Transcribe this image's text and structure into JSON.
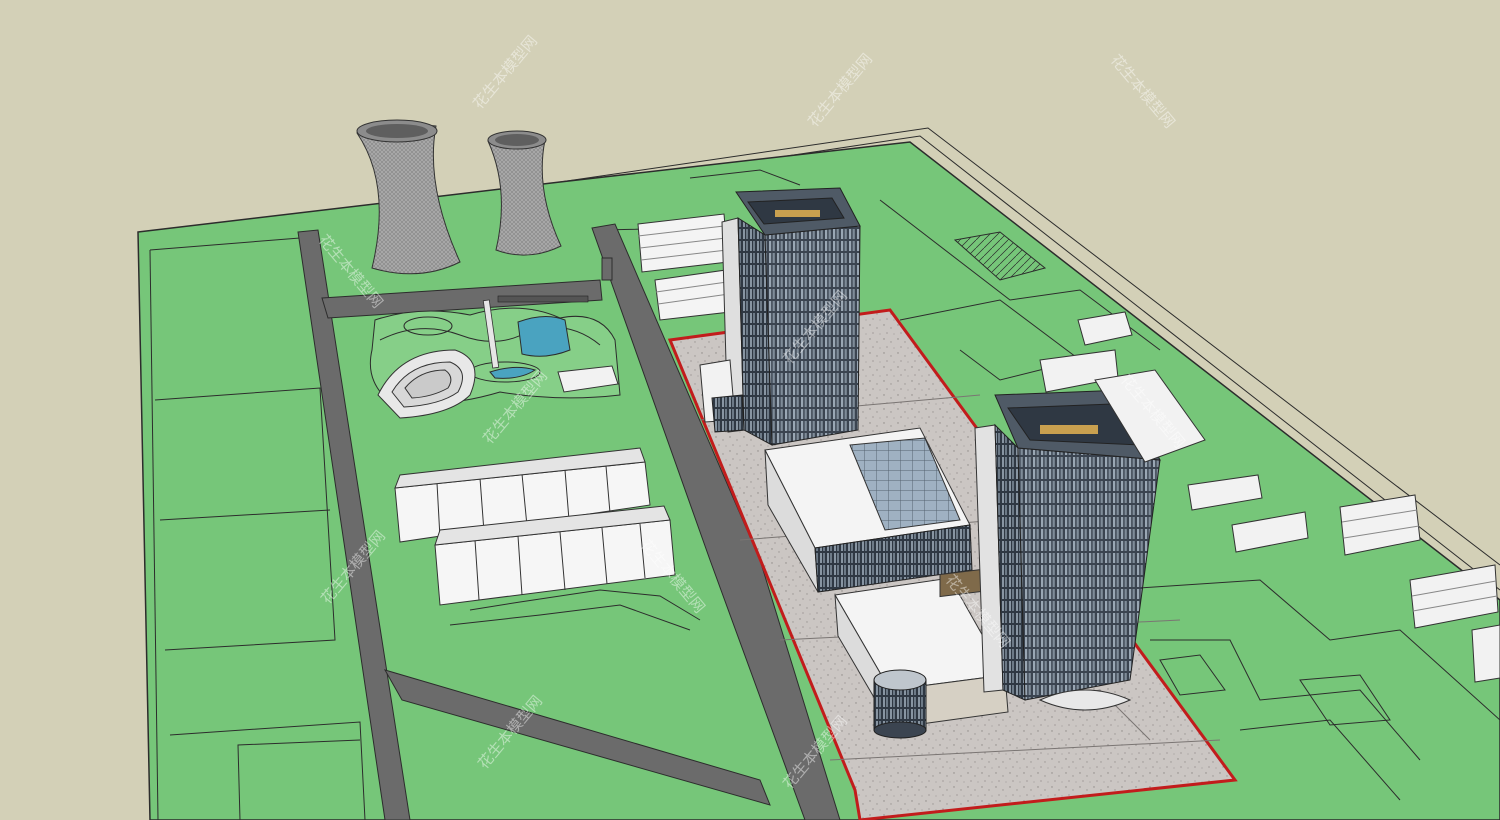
{
  "scene": {
    "kind": "3D architectural massing model",
    "colors": {
      "sky": "#d3d0b7",
      "lawn": "#76c679",
      "road": "#6b6b6b",
      "plaza": "#c9c4c1",
      "site_boundary": "#c21c1c",
      "building_white": "#f2f2f2",
      "tower_glass": "#3c4552",
      "cooling_tower": "#a8a8a8",
      "pond": "#4aa3c0"
    }
  },
  "watermark": {
    "text": "花生本模型网"
  }
}
